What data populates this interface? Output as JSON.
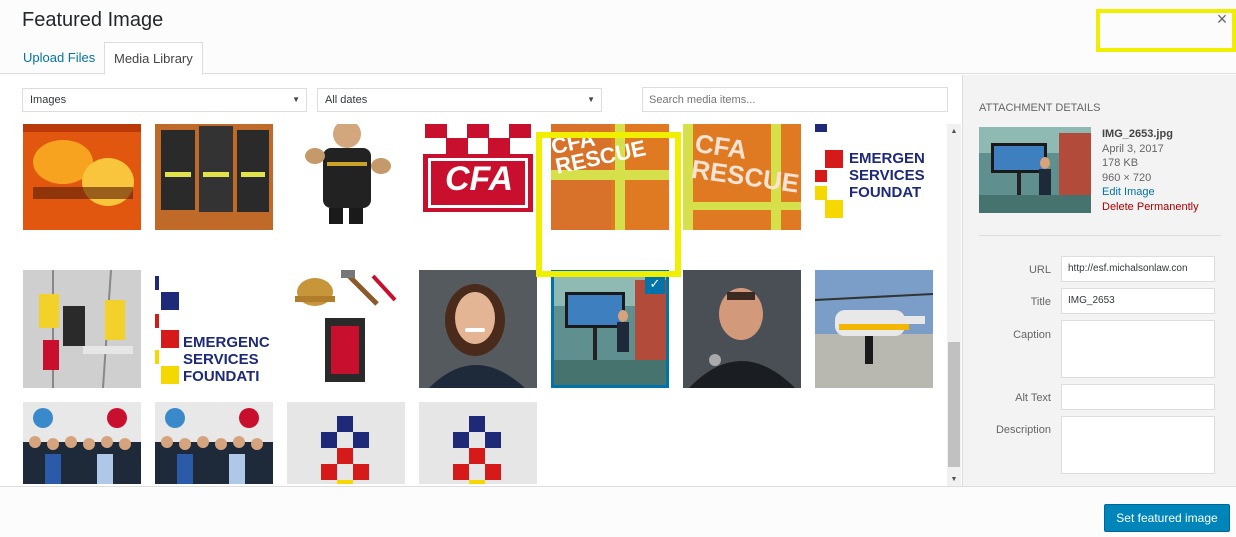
{
  "dialog": {
    "title": "Featured Image",
    "close_glyph": "×"
  },
  "tabs": [
    {
      "label": "Upload Files"
    },
    {
      "label": "Media Library"
    }
  ],
  "filters": {
    "type_selected": "Images",
    "date_selected": "All dates",
    "search_placeholder": "Search media items..."
  },
  "media": [
    {
      "name": "fire-scene"
    },
    {
      "name": "firefighters-uniforms"
    },
    {
      "name": "firefighter-figurine"
    },
    {
      "name": "cfa-logo",
      "text": "CFA"
    },
    {
      "name": "cfa-rescue-jacket",
      "text": "CFA RESCUE"
    },
    {
      "name": "cfa-rescue-jacket-2",
      "text": "CFA RESCUE"
    },
    {
      "name": "esf-logo",
      "text": [
        "EMERGEN",
        "SERVICES",
        "FOUNDAT"
      ]
    },
    {
      "name": "rope-rescue"
    },
    {
      "name": "esf-logo-2",
      "text": [
        "EMERGENC",
        "SERVICES",
        "FOUNDATI"
      ]
    },
    {
      "name": "helmet-and-tools"
    },
    {
      "name": "woman-portrait"
    },
    {
      "name": "img-2653",
      "selected": true
    },
    {
      "name": "officer-portrait"
    },
    {
      "name": "helicopter"
    },
    {
      "name": "group-photo"
    },
    {
      "name": "group-photo-2"
    },
    {
      "name": "esf-checker-logo"
    },
    {
      "name": "esf-checker-logo-2"
    }
  ],
  "attachment": {
    "heading": "ATTACHMENT DETAILS",
    "filename": "IMG_2653.jpg",
    "date": "April 3, 2017",
    "size": "178 KB",
    "dimensions": "960 × 720",
    "edit_link": "Edit Image",
    "delete_link": "Delete Permanently",
    "fields": {
      "url_label": "URL",
      "url_value": "http://esf.michalsonlaw.con",
      "title_label": "Title",
      "title_value": "IMG_2653",
      "caption_label": "Caption",
      "caption_value": "",
      "alt_label": "Alt Text",
      "alt_value": "",
      "description_label": "Description",
      "description_value": ""
    }
  },
  "footer": {
    "button_label": "Set featured image"
  },
  "colors": {
    "accent": "#0073aa",
    "button": "#0085ba",
    "highlight": "#f0ef00",
    "danger": "#a00000"
  },
  "icons": {
    "close": "close-icon",
    "check": "checkmark-icon",
    "dropdown": "chevron-down-icon"
  }
}
